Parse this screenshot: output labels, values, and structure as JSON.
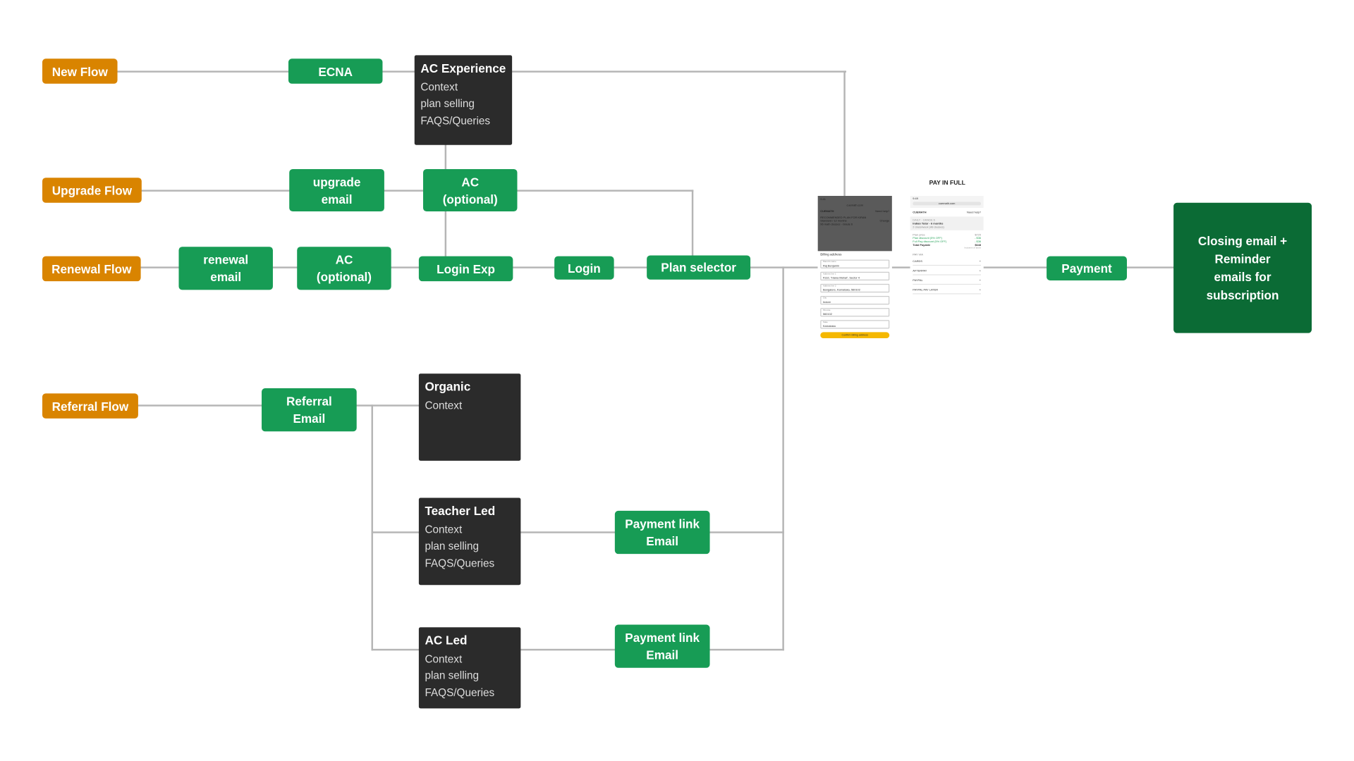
{
  "flows": {
    "new": "New Flow",
    "upgrade": "Upgrade Flow",
    "renewal": "Renewal Flow",
    "referral": "Referral Flow"
  },
  "nodes": {
    "ecna": "ECNA",
    "upgrade_email": "upgrade email",
    "ac_optional": "AC (optional)",
    "renewal_email": "renewal email",
    "ac_optional_2": "AC (optional)",
    "login_exp": "Login Exp",
    "login": "Login",
    "plan_selector": "Plan selector",
    "referral_email": "Referral Email",
    "payment_link_1": "Payment link Email",
    "payment_link_2": "Payment link Email",
    "payment": "Payment",
    "closing": "Closing email + Reminder emails for subscription"
  },
  "cards": {
    "ac_experience": {
      "title": "AC Experience",
      "lines": [
        "Context",
        "plan selling",
        "FAQS/Queries"
      ]
    },
    "organic": {
      "title": "Organic",
      "lines": [
        "Context"
      ]
    },
    "teacher_led": {
      "title": "Teacher Led",
      "lines": [
        "Context",
        "plan selling",
        "FAQS/Queries"
      ]
    },
    "ac_led": {
      "title": "AC Led",
      "lines": [
        "Context",
        "plan selling",
        "FAQS/Queries"
      ]
    }
  },
  "billing_screen": {
    "time": "9:41",
    "url": "cuemath.com",
    "brand": "CUEMATH",
    "help": "Need help?",
    "recommended": "RECOMMENDED PLAN FOR KIRAN",
    "plan": "Standard / 12 months",
    "change": "Change",
    "plan_sub": "96 math classes · Grade 6",
    "heading": "Billing address",
    "fields": [
      {
        "label": "Parent's name",
        "value": "Raj Benjamin"
      },
      {
        "label": "Address line 1",
        "value": "#132, \"Hawa Mahal\", Sector 4"
      },
      {
        "label": "Address line 2",
        "value": "Bangalore, Karnataka, 560102"
      },
      {
        "label": "City",
        "value": "Indore"
      },
      {
        "label": "Pincode",
        "value": "560102"
      },
      {
        "label": "State",
        "value": "Karnataka"
      }
    ],
    "confirm": "Confirm billing address"
  },
  "pay_screen": {
    "heading": "PAY IN FULL",
    "time": "9:49",
    "url": "cuemath.com",
    "brand": "CUEMATH",
    "help": "Need help?",
    "tag": "DAILY · GRADE 6",
    "plan": "Indian Tutor - 6 months",
    "plan_sub": "2 class/week (48 classes)",
    "lines": [
      {
        "label": "Plan price",
        "value": "$720"
      },
      {
        "label": "Plan discount (5% OFF)",
        "value": "- $36"
      },
      {
        "label": "Full Pay discount (5% OFF)",
        "value": "- $36"
      }
    ],
    "total_label": "Total Payable",
    "total": "$648",
    "tax": "Inclusive of taxes",
    "pay_via": "PAY VIA",
    "methods": [
      "CARDS",
      "AFTERPAY",
      "PAYPAL",
      "PAYPAL PAY LATER"
    ]
  },
  "colors": {
    "flow": "#d98400",
    "step": "#179c55",
    "card": "#2b2b2b",
    "closing": "#0b6b35",
    "connector": "#b5b5b5",
    "confirm": "#f5b800"
  }
}
